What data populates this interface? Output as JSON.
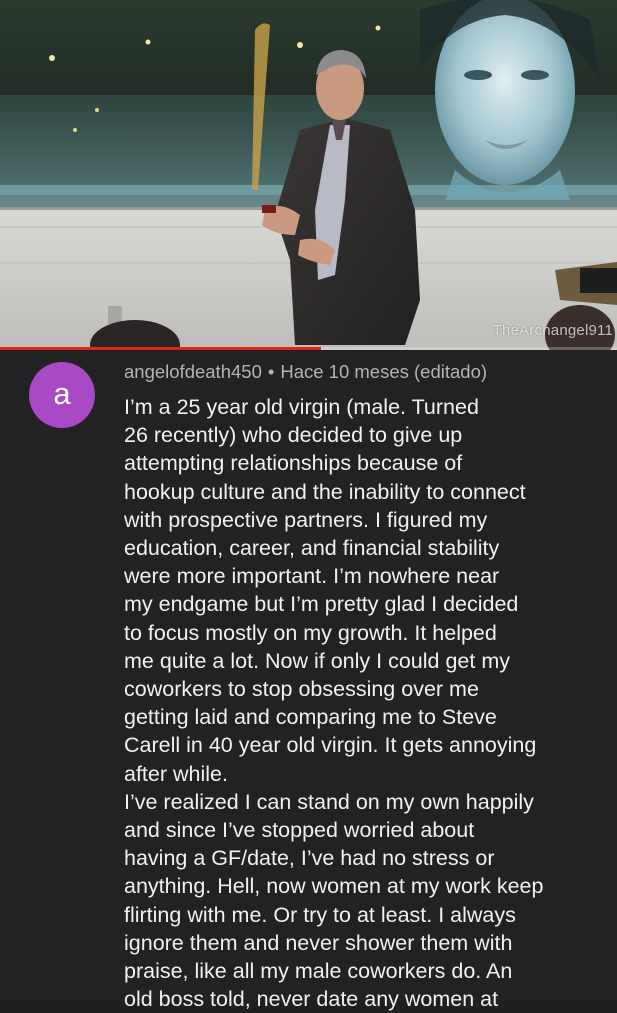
{
  "video": {
    "watermark": "TheArchangel911",
    "progress_fraction": 0.52,
    "progress_color": "#e1241a"
  },
  "comment": {
    "avatar_letter": "a",
    "avatar_color": "#a849c6",
    "author": "angelofdeath450",
    "separator": "•",
    "timestamp": "Hace 10 meses (editado)",
    "lines": [
      "I’m a 25 year old virgin (male. Turned",
      "26 recently) who decided to give up",
      "attempting relationships because of",
      "hookup culture and the inability to connect",
      "with prospective partners. I figured my",
      "education, career, and financial stability",
      "were more important. I’m nowhere near",
      "my endgame but I’m pretty glad I decided",
      "to focus mostly on my growth. It helped",
      "me quite a lot. Now if only I could get my",
      "coworkers to stop obsessing over me",
      "getting laid and comparing me to Steve",
      "Carell in 40 year old virgin. It gets annoying",
      "after while.",
      "I’ve realized I can stand on my own happily",
      "and since I’ve stopped worried about",
      "having a GF/date, I’ve had no stress or",
      "anything. Hell, now women at my work keep",
      "flirting with me. Or try to at least. I always",
      "ignore them and never shower them with",
      "praise, like all my male coworkers do. An",
      "old boss told, never date any women at"
    ]
  }
}
